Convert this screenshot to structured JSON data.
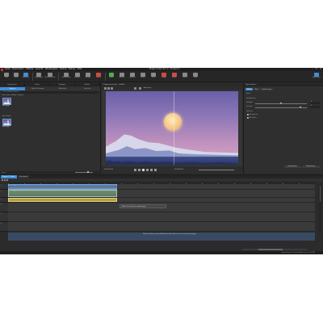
{
  "window": {
    "title": "Magix Video Pro X - Projekt 2",
    "menu": [
      "Datei",
      "Bearbeiten",
      "Effekte",
      "Ansicht",
      "Wiedergabe",
      "Online",
      "Extras",
      "Hilfe"
    ],
    "controls": [
      "–",
      "❐",
      "✕"
    ]
  },
  "toolbar": {
    "buttons": [
      {
        "label": "Neu",
        "icon": "new-file-icon"
      },
      {
        "label": "Öffnen",
        "icon": "open-folder-icon"
      },
      {
        "label": "Speichern",
        "icon": "save-icon"
      },
      {
        "label": "Rückgängig",
        "icon": "undo-icon"
      },
      {
        "label": "Wiederherstellen",
        "icon": "redo-icon"
      },
      {
        "label": "Ausschneiden",
        "icon": "cut-icon"
      },
      {
        "label": "Kopieren",
        "icon": "copy-icon"
      },
      {
        "label": "Einfügen",
        "icon": "paste-icon"
      },
      {
        "label": "Löschen",
        "icon": "delete-icon"
      },
      {
        "label": "Export",
        "icon": "export-icon"
      },
      {
        "label": "Brennen",
        "icon": "burn-icon"
      },
      {
        "label": "Vorschau",
        "icon": "preview-icon"
      },
      {
        "label": "Schnitt",
        "icon": "scissors-icon"
      },
      {
        "label": "Teilen",
        "icon": "split-icon"
      },
      {
        "label": "Gruppe",
        "icon": "group-icon"
      },
      {
        "label": "Marker",
        "icon": "marker-icon"
      },
      {
        "label": "Effekte",
        "icon": "effects-icon"
      },
      {
        "label": "Zoom",
        "icon": "zoom-icon"
      }
    ],
    "right_label": "Export Video"
  },
  "left_panel": {
    "tabs": [
      "Importieren",
      "Fotos",
      "Vorlagen",
      "Effekte"
    ],
    "subtabs": [
      "Dateien",
      "Objekte/Vorlagen",
      "Bibliothek",
      "Favoriten"
    ],
    "path": "C:\\Users\\Bilder\\Projekt",
    "section1": "Aus Ordner 'Bilder' / Projekt",
    "thumb1_label": "Mount.jpg",
    "section2": "Aus Projekt",
    "thumb2_label": "Mount.jpg",
    "bottom_label": "Zoom"
  },
  "preview": {
    "head_labels": [
      "Programmmonitor",
      "Vollbild"
    ],
    "zoom": "Anpassen",
    "timecode_left": "00:00:00:00",
    "timecode_right": "00:00:05:00"
  },
  "right_panel": {
    "header": "Eigenschaften",
    "tabs": [
      "Video",
      "Bild",
      "Optimierung"
    ],
    "section_effect": "Effekt",
    "section_color": "Farbkorrektur",
    "row_brightness": "Helligkeit",
    "row_contrast": "Kontrast",
    "val_brightness": "0",
    "val_contrast": "0",
    "section_options": "Optionen",
    "check1": "Automatisch",
    "check2": "Alle Bilder",
    "reset_button": "Zurücksetzen",
    "apply_button": "Übernehmen"
  },
  "timeline": {
    "tabs": [
      "Projekt 2 (Video)",
      "Storyboard"
    ],
    "tracks": [
      {
        "num": "1",
        "clip": "Mount.jpg",
        "type": "title"
      },
      {
        "num": "2",
        "clip": "Mount.jpg (Video)",
        "type": "video"
      },
      {
        "num": "3",
        "clip": "Audio 1",
        "type": "audio"
      },
      {
        "num": "4",
        "clip": "",
        "type": "none"
      },
      {
        "num": "5",
        "clip": "",
        "type": "none"
      },
      {
        "num": "6",
        "clip": "",
        "type": "none"
      }
    ],
    "tooltip": "Datei hier hinziehen und ablegen",
    "drop_message": "Ziehen Sie Medien aus dem Media Pool in diesen Bereich, um eine neue Spur anzulegen"
  },
  "status": "Projektlänge: 00:00:05:00   Auflösung: 1920x1080"
}
